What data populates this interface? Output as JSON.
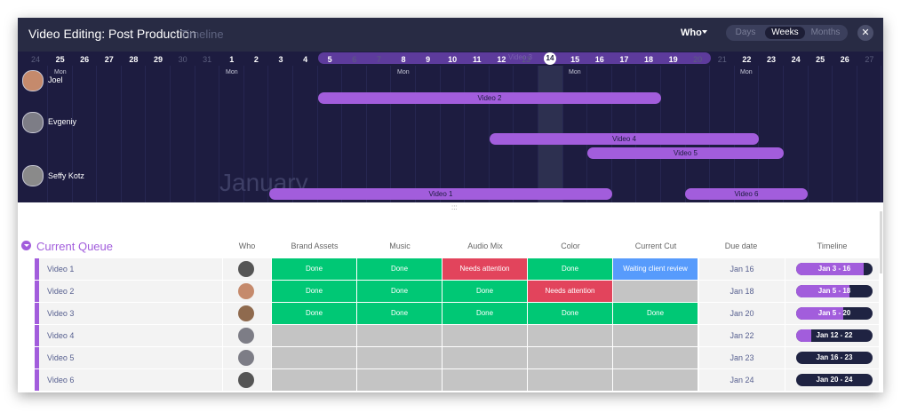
{
  "header": {
    "title": "Video Editing: Post Production",
    "subtitle": "Timeline",
    "who_label": "Who",
    "view_options": [
      "Days",
      "Weeks",
      "Months"
    ],
    "active_view": "Weeks",
    "close_icon": "close-icon"
  },
  "timeline": {
    "days": [
      "24",
      "25",
      "26",
      "27",
      "28",
      "29",
      "30",
      "31",
      "1",
      "2",
      "3",
      "4",
      "5",
      "6",
      "7",
      "8",
      "9",
      "10",
      "11",
      "12",
      "13",
      "14",
      "15",
      "16",
      "17",
      "18",
      "19",
      "20",
      "21",
      "22",
      "23",
      "24",
      "25",
      "26",
      "27"
    ],
    "dim_days": [
      0,
      6,
      7,
      13,
      14,
      20,
      27,
      28,
      34
    ],
    "today": "14",
    "mon_label": "Mon",
    "range_label": "Video 3",
    "month_label": "January",
    "people": [
      {
        "name": "Joel",
        "avatar_color": "#c58a6c"
      },
      {
        "name": "Evgeniy",
        "avatar_color": "#7d7d86"
      },
      {
        "name": "Seffy Kotz",
        "avatar_color": "#8a8a8a"
      }
    ],
    "bars": [
      {
        "label": "Video 2"
      },
      {
        "label": "Video 4"
      },
      {
        "label": "Video 5"
      },
      {
        "label": "Video 1"
      },
      {
        "label": "Video 6"
      }
    ]
  },
  "table": {
    "group_name": "Current Queue",
    "columns": [
      "Who",
      "Brand Assets",
      "Music",
      "Audio Mix",
      "Color",
      "Current Cut",
      "Due date",
      "Timeline"
    ],
    "colors": {
      "done": "#00c875",
      "needs_attention": "#e2445c",
      "waiting": "#579bfc",
      "empty": "#c4c4c4"
    },
    "rows": [
      {
        "name": "Video 1",
        "avatar": "#555555",
        "brand": "Done",
        "music": "Done",
        "audio": "Needs attention",
        "color": "Done",
        "cut": "Waiting client review",
        "due": "Jan 16",
        "timeline": "Jan 3 - 16",
        "progress": 0.88
      },
      {
        "name": "Video 2",
        "avatar": "#c58a6c",
        "brand": "Done",
        "music": "Done",
        "audio": "Done",
        "color": "Needs attention",
        "cut": "",
        "due": "Jan 18",
        "timeline": "Jan 5 - 18",
        "progress": 0.7
      },
      {
        "name": "Video 3",
        "avatar": "#8f6a4e",
        "brand": "Done",
        "music": "Done",
        "audio": "Done",
        "color": "Done",
        "cut": "Done",
        "due": "Jan 20",
        "timeline": "Jan 5 - 20",
        "progress": 0.62
      },
      {
        "name": "Video 4",
        "avatar": "#7d7d86",
        "brand": "",
        "music": "",
        "audio": "",
        "color": "",
        "cut": "",
        "due": "Jan 22",
        "timeline": "Jan 12 - 22",
        "progress": 0.2
      },
      {
        "name": "Video 5",
        "avatar": "#7d7d86",
        "brand": "",
        "music": "",
        "audio": "",
        "color": "",
        "cut": "",
        "due": "Jan 23",
        "timeline": "Jan 16 - 23",
        "progress": 0
      },
      {
        "name": "Video 6",
        "avatar": "#555555",
        "brand": "",
        "music": "",
        "audio": "",
        "color": "",
        "cut": "",
        "due": "Jan 24",
        "timeline": "Jan 20 - 24",
        "progress": 0
      }
    ]
  }
}
